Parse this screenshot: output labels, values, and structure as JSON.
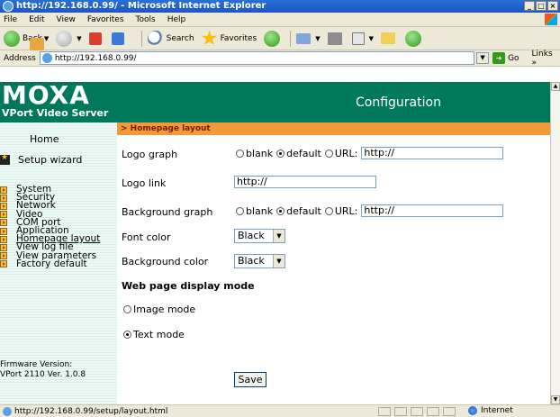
{
  "window": {
    "title": "http://192.168.0.99/ - Microsoft Internet Explorer"
  },
  "menu": [
    "File",
    "Edit",
    "View",
    "Favorites",
    "Tools",
    "Help"
  ],
  "toolbar": {
    "back": "Back",
    "search": "Search",
    "favorites": "Favorites"
  },
  "address": {
    "label": "Address",
    "url": "http://192.168.0.99/",
    "go": "Go",
    "links": "Links"
  },
  "header": {
    "brand": "MOXA",
    "product": "VPort Video Server",
    "title": "Configuration"
  },
  "sidebar": {
    "home": "Home",
    "wizard": "Setup wizard",
    "items": [
      {
        "label": "System"
      },
      {
        "label": "Security"
      },
      {
        "label": "Network"
      },
      {
        "label": "Video"
      },
      {
        "label": "COM port"
      },
      {
        "label": "Application"
      },
      {
        "label": "Homepage layout"
      },
      {
        "label": "View log file"
      },
      {
        "label": "View parameters"
      },
      {
        "label": "Factory default"
      }
    ],
    "firmware_label": "Firmware Version:",
    "firmware_value": "VPort 2110 Ver. 1.0.8"
  },
  "main": {
    "breadcrumb": "> Homepage layout",
    "logo_graph": {
      "label": "Logo graph",
      "options": [
        "blank",
        "default",
        "URL:"
      ],
      "selected": "default",
      "url": "http://"
    },
    "logo_link": {
      "label": "Logo link",
      "value": "http://"
    },
    "background_graph": {
      "label": "Background graph",
      "options": [
        "blank",
        "default",
        "URL:"
      ],
      "selected": "default",
      "url": "http://"
    },
    "font_color": {
      "label": "Font color",
      "value": "Black"
    },
    "background_color": {
      "label": "Background color",
      "value": "Black"
    },
    "display_mode": {
      "title": "Web page display mode",
      "image_mode": "Image mode",
      "text_mode": "Text mode",
      "selected": "Text mode"
    },
    "save": "Save"
  },
  "status": {
    "url": "http://192.168.0.99/setup/layout.html",
    "zone": "Internet"
  }
}
